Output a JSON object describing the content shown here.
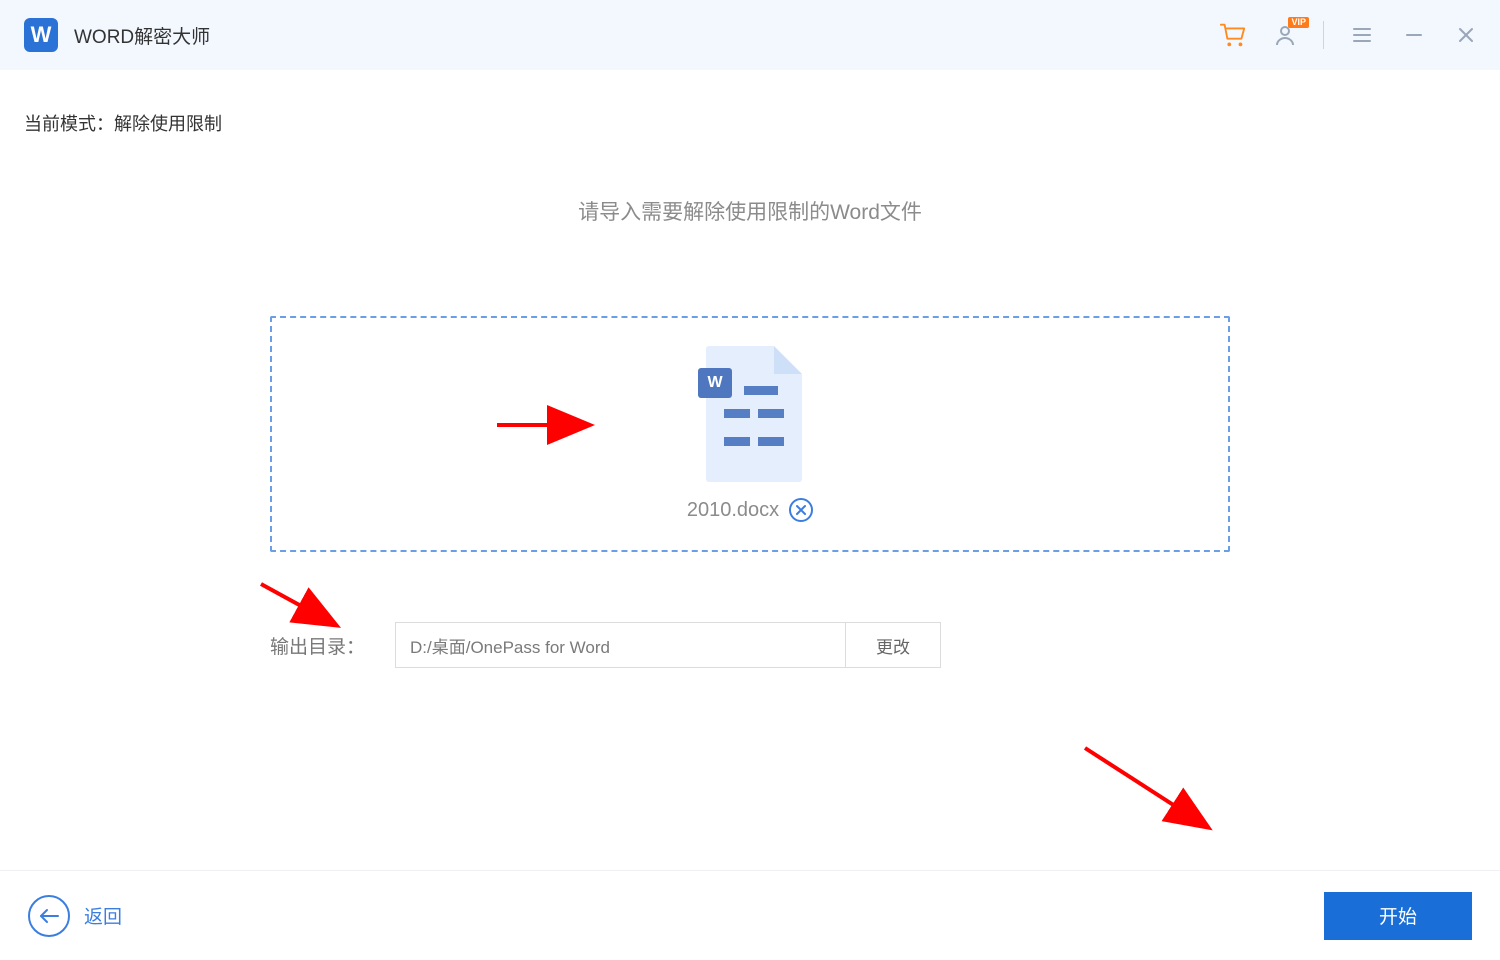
{
  "header": {
    "app_icon_letter": "W",
    "app_title": "WORD解密大师",
    "vip_badge": "VIP"
  },
  "main": {
    "mode_label": "当前模式：",
    "mode_value": "解除使用限制",
    "instruction": "请导入需要解除使用限制的Word文件",
    "doc_icon_letter": "W",
    "file_name": "2010.docx",
    "output_label": "输出目录：",
    "output_path": "D:/桌面/OnePass for Word",
    "change_btn": "更改"
  },
  "footer": {
    "back_label": "返回",
    "start_label": "开始"
  }
}
